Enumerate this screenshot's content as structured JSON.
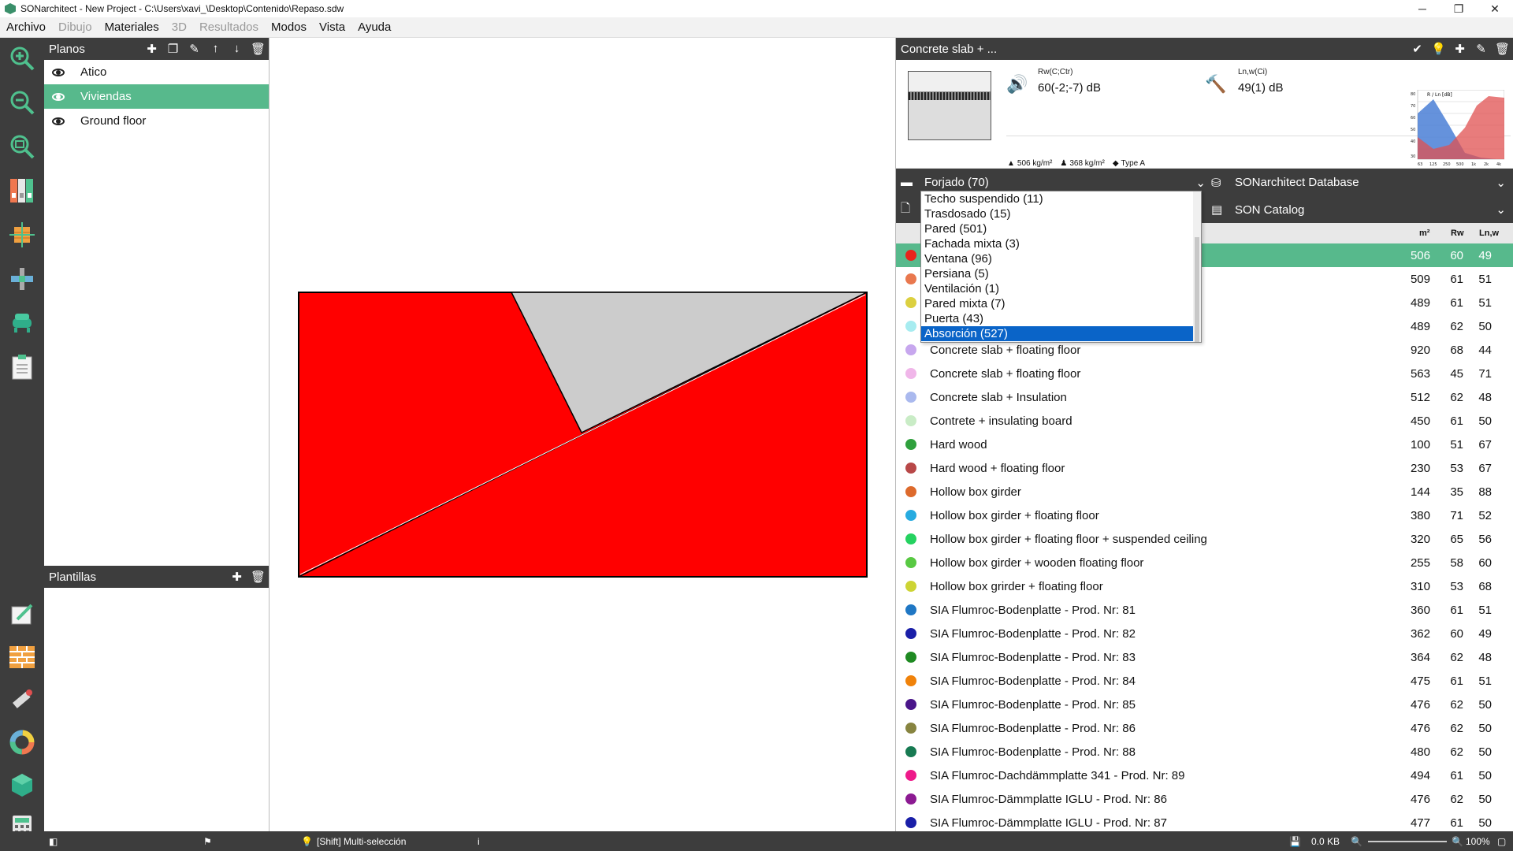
{
  "window": {
    "title": "SONarchitect - New Project - C:\\Users\\xavi_\\Desktop\\Contenido\\Repaso.sdw",
    "minimize": "─",
    "restore": "❐",
    "close": "✕"
  },
  "menu": [
    {
      "label": "Archivo",
      "enabled": true
    },
    {
      "label": "Dibujo",
      "enabled": false
    },
    {
      "label": "Materiales",
      "enabled": true
    },
    {
      "label": "3D",
      "enabled": false
    },
    {
      "label": "Resultados",
      "enabled": false
    },
    {
      "label": "Modos",
      "enabled": true
    },
    {
      "label": "Vista",
      "enabled": true
    },
    {
      "label": "Ayuda",
      "enabled": true
    }
  ],
  "planos": {
    "title": "Planos",
    "items": [
      {
        "label": "Atico",
        "selected": false
      },
      {
        "label": "Viviendas",
        "selected": true
      },
      {
        "label": "Ground floor",
        "selected": false
      }
    ]
  },
  "plantillas": {
    "title": "Plantillas"
  },
  "material_detail": {
    "title": "Concrete slab + ...",
    "rw_label": "Rw(C;Ctr)",
    "rw_value": "60(-2;-7) dB",
    "lnw_label": "Ln,w(Ci)",
    "lnw_value": "49(1) dB",
    "mass1": "506 kg/m²",
    "mass2": "368 kg/m²",
    "type": "Type A",
    "graph_label": "R / Ln [dB]",
    "graph_y_ticks": [
      "80",
      "70",
      "60",
      "50",
      "40",
      "30"
    ],
    "graph_x_ticks": [
      "63",
      "125",
      "250",
      "500",
      "1k",
      "2k",
      "4k"
    ],
    "colors": {
      "rw": "#4a7fd6",
      "lnw": "#e05050"
    }
  },
  "filters": {
    "category": "Forjado (70)",
    "database": "SONarchitect Database",
    "catalog": "SON Catalog"
  },
  "dropdown_options": [
    {
      "label": "Techo suspendido (11)",
      "active": false
    },
    {
      "label": "Trasdosado (15)",
      "active": false
    },
    {
      "label": "Pared (501)",
      "active": false
    },
    {
      "label": "Fachada mixta (3)",
      "active": false
    },
    {
      "label": "Ventana (96)",
      "active": false
    },
    {
      "label": "Persiana (5)",
      "active": false
    },
    {
      "label": "Ventilación (1)",
      "active": false
    },
    {
      "label": "Pared mixta (7)",
      "active": false
    },
    {
      "label": "Puerta (43)",
      "active": false
    },
    {
      "label": "Absorción (527)",
      "active": true
    }
  ],
  "columns": {
    "mass": "m²",
    "rw": "Rw",
    "lnw": "Ln,w"
  },
  "materials": [
    {
      "name": "",
      "m": "506",
      "rw": "60",
      "lnw": "49",
      "color": "#e8231b",
      "selected": true
    },
    {
      "name": "",
      "m": "509",
      "rw": "61",
      "lnw": "51",
      "color": "#e9784e",
      "selected": false
    },
    {
      "name": "",
      "m": "489",
      "rw": "61",
      "lnw": "51",
      "color": "#dcd040",
      "selected": false
    },
    {
      "name": "",
      "m": "489",
      "rw": "62",
      "lnw": "50",
      "color": "#a7ecf0",
      "selected": false
    },
    {
      "name": "Concrete slab + floating floor",
      "m": "920",
      "rw": "68",
      "lnw": "44",
      "color": "#c7a7ee",
      "selected": false
    },
    {
      "name": "Concrete slab + floating floor",
      "m": "563",
      "rw": "45",
      "lnw": "71",
      "color": "#f0b6e9",
      "selected": false
    },
    {
      "name": "Concrete slab + Insulation",
      "m": "512",
      "rw": "62",
      "lnw": "48",
      "color": "#aab9ee",
      "selected": false
    },
    {
      "name": "Contrete + insulating board",
      "m": "450",
      "rw": "61",
      "lnw": "50",
      "color": "#c9ecc6",
      "selected": false
    },
    {
      "name": "Hard wood",
      "m": "100",
      "rw": "51",
      "lnw": "67",
      "color": "#2fa03d",
      "selected": false
    },
    {
      "name": "Hard wood + floating floor",
      "m": "230",
      "rw": "53",
      "lnw": "67",
      "color": "#b84848",
      "selected": false
    },
    {
      "name": "Hollow box girder",
      "m": "144",
      "rw": "35",
      "lnw": "88",
      "color": "#dd6a2c",
      "selected": false
    },
    {
      "name": "Hollow box girder + floating floor",
      "m": "380",
      "rw": "71",
      "lnw": "52",
      "color": "#27abe0",
      "selected": false
    },
    {
      "name": "Hollow box girder + floating floor + suspended ceiling",
      "m": "320",
      "rw": "65",
      "lnw": "56",
      "color": "#25d260",
      "selected": false
    },
    {
      "name": "Hollow box girder + wooden floating floor",
      "m": "255",
      "rw": "58",
      "lnw": "60",
      "color": "#58c943",
      "selected": false
    },
    {
      "name": "Hollow box grirder + floating floor",
      "m": "310",
      "rw": "53",
      "lnw": "68",
      "color": "#cdd434",
      "selected": false
    },
    {
      "name": "SIA Flumroc-Bodenplatte - Prod. Nr: 81",
      "m": "360",
      "rw": "61",
      "lnw": "51",
      "color": "#1f77c4",
      "selected": false
    },
    {
      "name": "SIA Flumroc-Bodenplatte - Prod. Nr: 82",
      "m": "362",
      "rw": "60",
      "lnw": "49",
      "color": "#1a1fa8",
      "selected": false
    },
    {
      "name": "SIA Flumroc-Bodenplatte - Prod. Nr: 83",
      "m": "364",
      "rw": "62",
      "lnw": "48",
      "color": "#1f8a22",
      "selected": false
    },
    {
      "name": "SIA Flumroc-Bodenplatte - Prod. Nr: 84",
      "m": "475",
      "rw": "61",
      "lnw": "51",
      "color": "#f0820a",
      "selected": false
    },
    {
      "name": "SIA Flumroc-Bodenplatte - Prod. Nr: 85",
      "m": "476",
      "rw": "62",
      "lnw": "50",
      "color": "#4a168a",
      "selected": false
    },
    {
      "name": "SIA Flumroc-Bodenplatte - Prod. Nr: 86",
      "m": "476",
      "rw": "62",
      "lnw": "50",
      "color": "#878440",
      "selected": false
    },
    {
      "name": "SIA Flumroc-Bodenplatte - Prod. Nr: 88",
      "m": "480",
      "rw": "62",
      "lnw": "50",
      "color": "#177a52",
      "selected": false
    },
    {
      "name": "SIA Flumroc-Dachdämmplatte  341 - Prod. Nr: 89",
      "m": "494",
      "rw": "61",
      "lnw": "50",
      "color": "#ee1a8a",
      "selected": false
    },
    {
      "name": "SIA Flumroc-Dämmplatte IGLU - Prod. Nr: 86",
      "m": "476",
      "rw": "62",
      "lnw": "50",
      "color": "#8c1a92",
      "selected": false
    },
    {
      "name": "SIA Flumroc-Dämmplatte IGLU - Prod. Nr: 87",
      "m": "477",
      "rw": "61",
      "lnw": "50",
      "color": "#1a1fa8",
      "selected": false
    }
  ],
  "status": {
    "hint": "[Shift] Multi-selección",
    "info": "i",
    "size": "0.0 KB",
    "zoom": "100%"
  }
}
